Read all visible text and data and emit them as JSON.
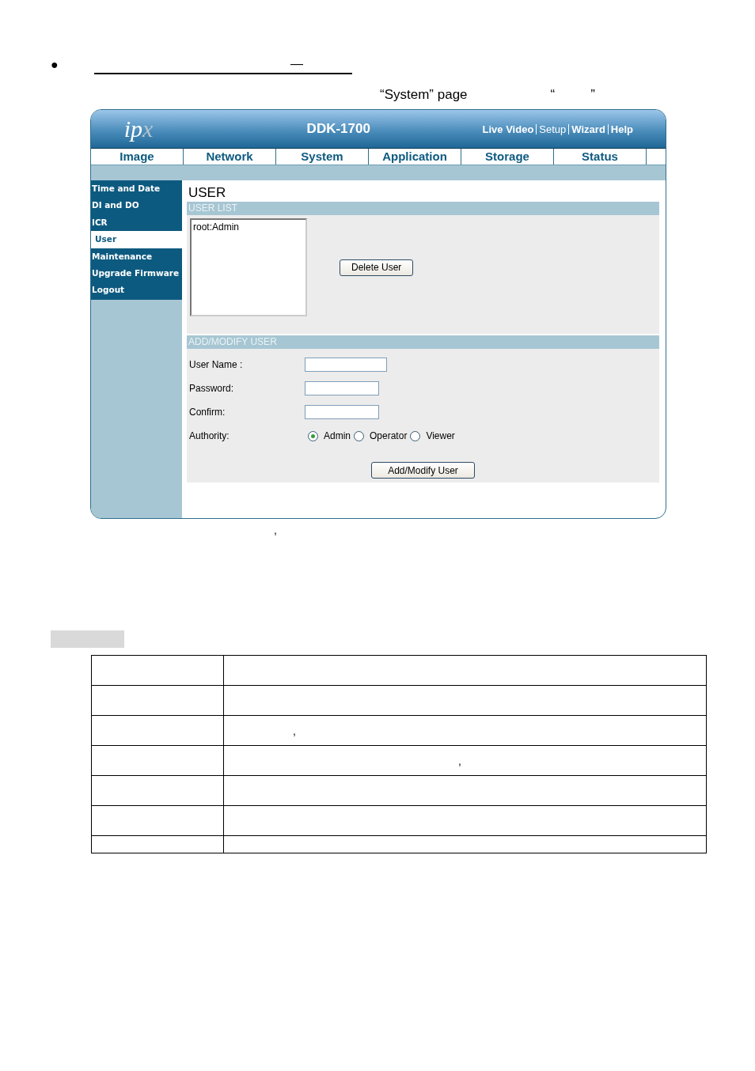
{
  "document": {
    "bullet": "●",
    "heading_dash": "—",
    "caption_texts": [
      {
        "text": "“System” page"
      },
      {
        "text": "“"
      },
      {
        "text": "”"
      }
    ],
    "after_comma": ","
  },
  "app": {
    "logo": {
      "main": "ip",
      "accent": "x"
    },
    "title": "DDK-1700",
    "header_links": [
      {
        "label": "Live Video",
        "selected": false
      },
      {
        "label": "Setup",
        "selected": true
      },
      {
        "label": "Wizard",
        "selected": false
      },
      {
        "label": "Help",
        "selected": false
      }
    ],
    "tabs": [
      {
        "label": "Image"
      },
      {
        "label": "Network"
      },
      {
        "label": "System"
      },
      {
        "label": "Application"
      },
      {
        "label": "Storage"
      },
      {
        "label": "Status"
      }
    ],
    "sidebar": {
      "items": [
        {
          "label": "Time and Date",
          "selected": false
        },
        {
          "label": "DI and DO",
          "selected": false
        },
        {
          "label": "ICR",
          "selected": false
        },
        {
          "label": "User",
          "selected": true
        },
        {
          "label": "Maintenance",
          "selected": false
        },
        {
          "label": "Upgrade Firmware",
          "selected": false
        },
        {
          "label": "Logout",
          "selected": false
        }
      ]
    },
    "page_title": "USER",
    "user_list": {
      "header": "USER LIST",
      "items": [
        "root:Admin"
      ],
      "delete_button": "Delete User"
    },
    "add_modify": {
      "header": "ADD/MODIFY USER",
      "fields": [
        {
          "label": "User Name :"
        },
        {
          "label": "Password:"
        },
        {
          "label": "Confirm:"
        }
      ],
      "authority": {
        "label": "Authority:",
        "options": [
          {
            "label": "Admin",
            "selected": true
          },
          {
            "label": "Operator",
            "selected": false
          },
          {
            "label": "Viewer",
            "selected": false
          }
        ]
      },
      "submit_button": "Add/Modify User"
    }
  },
  "table": {
    "rows": [
      {},
      {},
      {
        "column_2": ","
      },
      {
        "column_2": ","
      },
      {},
      {},
      {}
    ]
  }
}
